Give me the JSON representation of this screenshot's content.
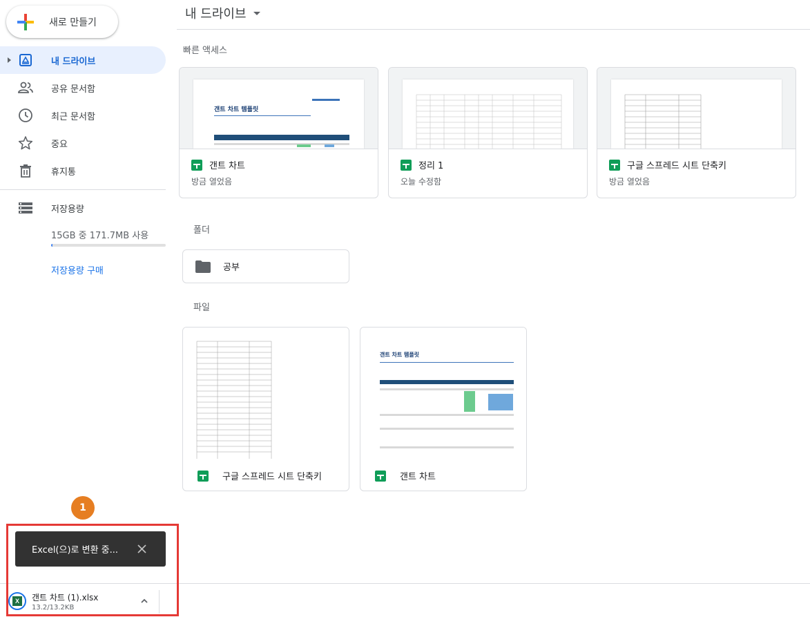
{
  "sidebar": {
    "new_label": "새로 만들기",
    "items": [
      {
        "label": "내 드라이브",
        "icon": "drive-icon",
        "active": true
      },
      {
        "label": "공유 문서함",
        "icon": "people-icon"
      },
      {
        "label": "최근 문서함",
        "icon": "clock-icon"
      },
      {
        "label": "중요",
        "icon": "star-icon"
      },
      {
        "label": "휴지통",
        "icon": "trash-icon"
      }
    ],
    "storage_label": "저장용량",
    "storage_used": "15GB 중 171.7MB 사용",
    "storage_fraction": 0.011,
    "buy_storage": "저장용량 구매"
  },
  "header": {
    "title": "내 드라이브"
  },
  "quick_access": {
    "title": "빠른 액세스",
    "cards": [
      {
        "name": "갠트 차트",
        "subtitle": "방금 열었음",
        "thumb_title": "갠트 차트 템플릿"
      },
      {
        "name": "정리 1",
        "subtitle": "오늘 수정함"
      },
      {
        "name": "구글 스프레드 시트 단축키",
        "subtitle": "방금 열었음"
      }
    ]
  },
  "folders": {
    "title": "폴더",
    "items": [
      {
        "name": "공부"
      }
    ]
  },
  "files": {
    "title": "파일",
    "items": [
      {
        "name": "구글 스프레드 시트 단축키"
      },
      {
        "name": "갠트 차트",
        "thumb_title": "갠트 차트 템플릿"
      }
    ]
  },
  "overlay": {
    "badge": "1",
    "snackbar_message": "Excel(으)로 변환 중...",
    "download_name": "갠트 차트 (1).xlsx",
    "download_size": "13.2/13.2KB"
  },
  "colors": {
    "accent": "#1a73e8",
    "active_bg": "#e8f0fe",
    "sheets_green": "#0f9d58",
    "badge_orange": "#e67e22",
    "highlight_red": "#e53935"
  }
}
